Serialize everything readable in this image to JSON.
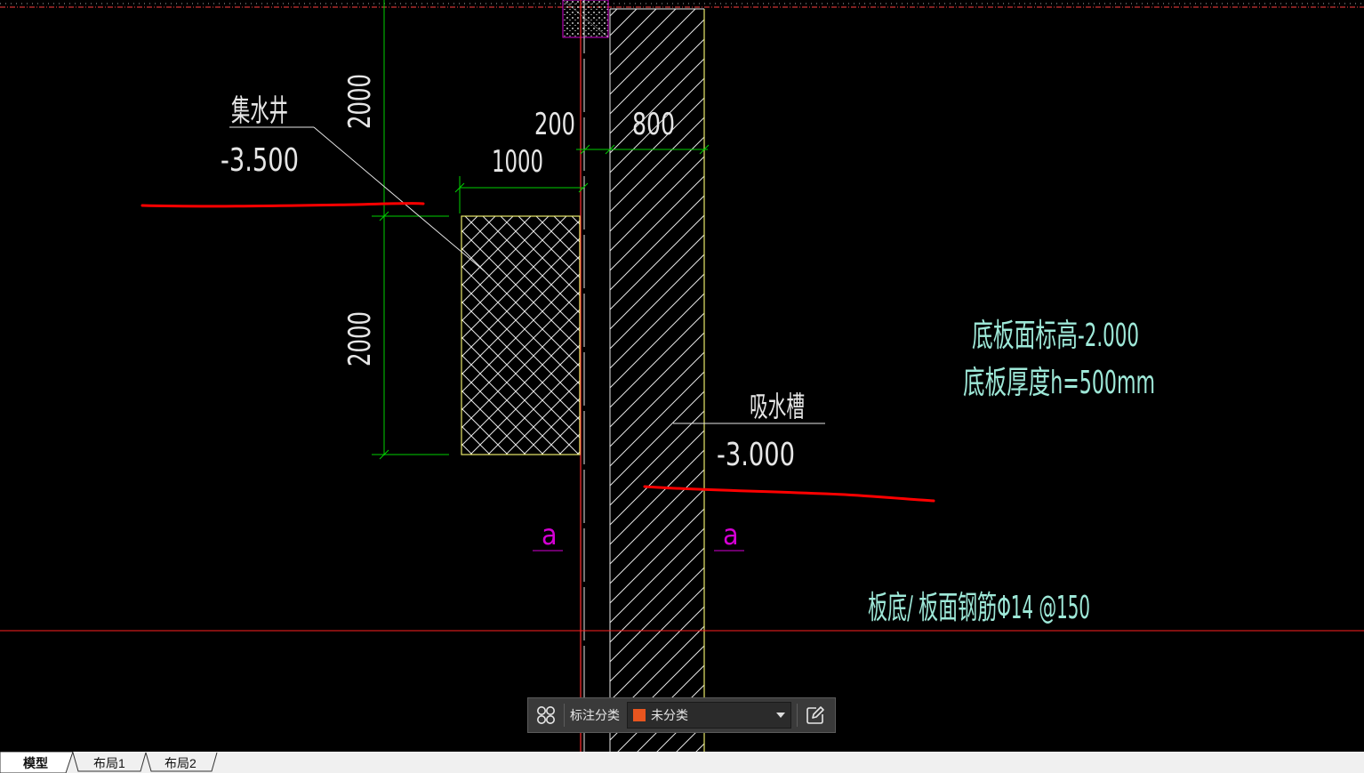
{
  "drawing": {
    "well_name": "集水井",
    "well_elevation": "-3.500",
    "dim_well_upper": "2000",
    "dim_well_lower": "2000",
    "dim_1000": "1000",
    "dim_200": "200",
    "dim_800": "800",
    "trough_name": "吸水槽",
    "trough_elevation": "-3.000",
    "section_mark_left": "a",
    "section_mark_right": "a",
    "slab_elevation": "底板面标高-2.000",
    "slab_thickness": "底板厚度h=500mm",
    "rebar_note": "板底/ 板面钢筋Φ14 @150"
  },
  "toolbar": {
    "category_label": "标注分类",
    "selected_category": "未分类",
    "icons": [
      "layout-grid-icon",
      "chevron-down-icon",
      "edit-icon"
    ]
  },
  "tabs": [
    {
      "label": "模型",
      "active": true
    },
    {
      "label": "布局1",
      "active": false
    },
    {
      "label": "布局2",
      "active": false
    }
  ],
  "colors": {
    "background": "#000000",
    "dimension_green": "#00d000",
    "outline_yellow": "#e8e86a",
    "text_cyan": "#9ee8d8",
    "annotation_red": "#ff0000",
    "section_magenta": "#d400d4",
    "swatch_orange": "#e8551f"
  }
}
